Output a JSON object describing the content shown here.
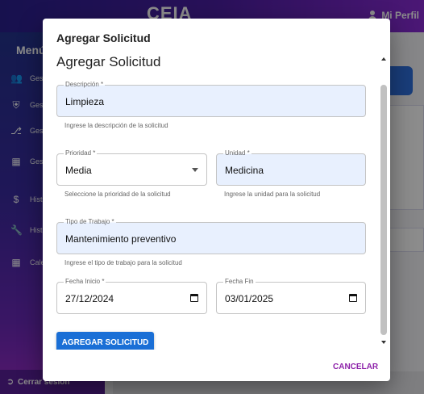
{
  "app": {
    "title": "CEIA",
    "profile_label": "Mi Perfil"
  },
  "sidebar": {
    "menu_title": "Menú",
    "items": [
      {
        "label": "Gest",
        "icon": "users-icon"
      },
      {
        "label": "Gest",
        "icon": "shield-icon"
      },
      {
        "label": "Gest",
        "icon": "hierarchy-icon"
      },
      {
        "label": "Gest Soli",
        "icon": "document-icon"
      },
      {
        "label": "Hist Man",
        "icon": "dollar-icon"
      },
      {
        "label": "Hist",
        "icon": "wrench-icon"
      },
      {
        "label": "Cale Trab",
        "icon": "calendar-icon"
      }
    ],
    "logout_label": "Cerrar sesión"
  },
  "dialog": {
    "title": "Agregar Solicitud",
    "form_title": "Agregar Solicitud",
    "descripcion": {
      "label": "Descripción *",
      "value": "Limpieza",
      "helper": "Ingrese la descripción de la solicitud"
    },
    "prioridad": {
      "label": "Prioridad *",
      "value": "Media",
      "helper": "Seleccione la prioridad de la solicitud"
    },
    "unidad": {
      "label": "Unidad *",
      "value": "Medicina",
      "helper": "Ingrese la unidad para la solicitud"
    },
    "tipo_trabajo": {
      "label": "Tipo de Trabajo *",
      "value": "Mantenimiento preventivo",
      "helper": "Ingrese el tipo de trabajo para la solicitud"
    },
    "fecha_inicio": {
      "label": "Fecha Inicio *",
      "value": "27/12/2024"
    },
    "fecha_fin": {
      "label": "Fecha Fin",
      "value": "03/01/2025"
    },
    "submit_label": "AGREGAR SOLICITUD",
    "cancel_label": "CANCELAR"
  },
  "colors": {
    "primary": "#1a6fd6",
    "cancel": "#8e24aa",
    "field_fill": "#e8f0fe"
  }
}
